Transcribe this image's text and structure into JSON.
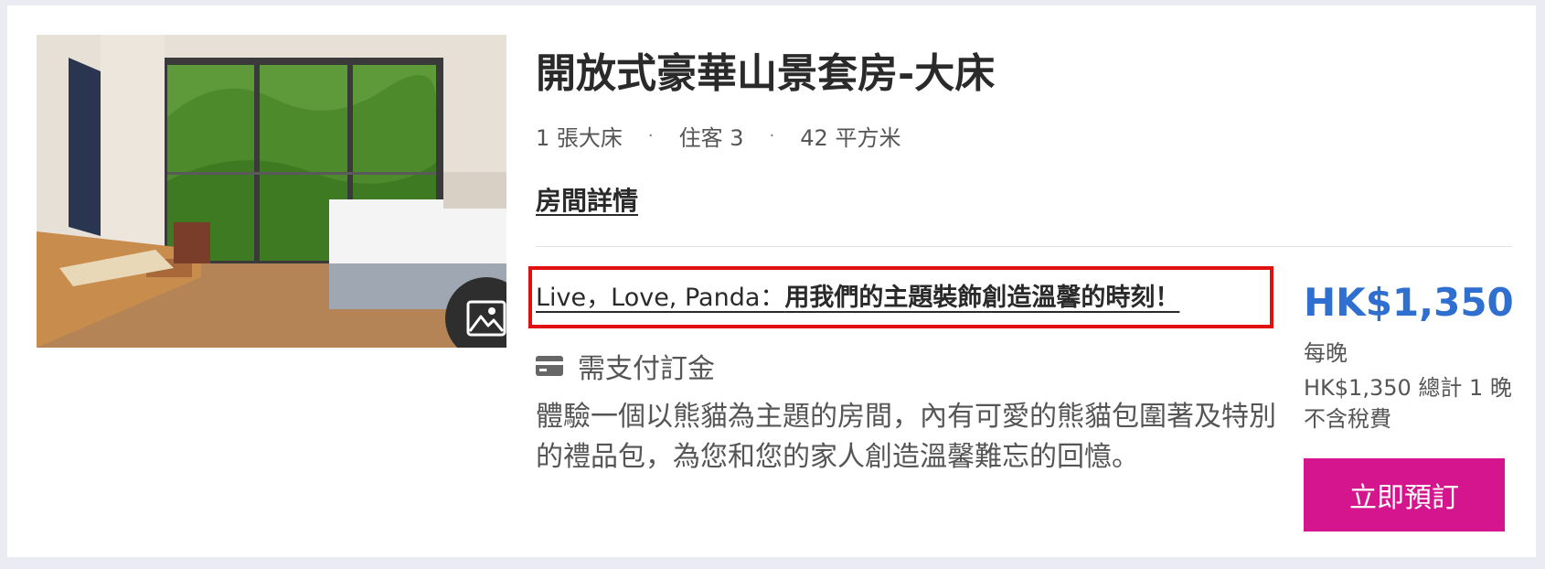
{
  "room": {
    "title": "開放式豪華山景套房-大床",
    "specs": {
      "bed": "1 張大床",
      "guests": "住客 3",
      "size": "42 平方米",
      "separator": "·"
    },
    "details_link": "房間詳情"
  },
  "photo": {
    "alt": "room-photo",
    "gallery_icon": "image-gallery-icon"
  },
  "promo": {
    "prefix": "Live，Love, Panda：",
    "text": "用我們的主題裝飾創造溫馨的時刻！",
    "highlight_color": "#e01010"
  },
  "deposit": {
    "icon": "credit-card-icon",
    "label": "需支付訂金"
  },
  "description": "體驗一個以熊貓為主題的房間，內有可愛的熊貓包圍著及特別的禮品包，為您和您的家人創造溫馨難忘的回憶。",
  "pricing": {
    "price": "HK$1,350",
    "per_night": "每晚",
    "total": "HK$1,350 總計 1 晚",
    "tax_note": "不含稅費",
    "price_color": "#2f6fd0"
  },
  "actions": {
    "book_label": "立即預訂",
    "book_color": "#d4158e"
  }
}
